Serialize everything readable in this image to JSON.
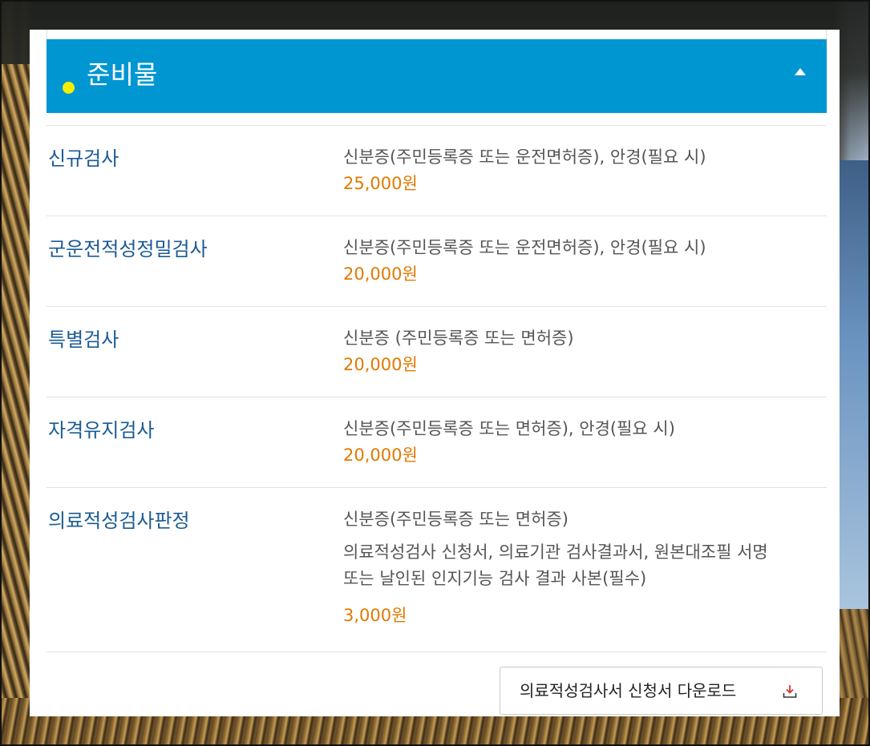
{
  "section": {
    "title": "준비물",
    "collapse_icon": "triangle-up-icon",
    "accent_color": "#0096d2",
    "dot_color": "#f4ee00"
  },
  "rows": [
    {
      "name": "신규검사",
      "requirement": "신분증(주민등록증 또는 운전면허증), 안경(필요 시)",
      "price": "25,000원"
    },
    {
      "name": "군운전적성정밀검사",
      "requirement": "신분증(주민등록증 또는 운전면허증), 안경(필요 시)",
      "price": "20,000원"
    },
    {
      "name": "특별검사",
      "requirement": "신분증 (주민등록증 또는 면허증)",
      "price": "20,000원"
    },
    {
      "name": "자격유지검사",
      "requirement": "신분증(주민등록증 또는 면허증), 안경(필요 시)",
      "price": "20,000원"
    },
    {
      "name": "의료적성검사판정",
      "requirement": "신분증(주민등록증 또는 면허증)",
      "requirement_extra_line1": "의료적성검사 신청서, 의료기관 검사결과서, 원본대조필 서명",
      "requirement_extra_line2": "또는 날인된 인지기능 검사 결과 사본(필수)",
      "price": "3,000원"
    }
  ],
  "download": {
    "label": "의료적성검사서 신청서 다운로드",
    "icon": "download-icon",
    "icon_color": "#e0302a"
  },
  "colors": {
    "row_name": "#1b5b94",
    "price": "#e07a00",
    "text": "#555555"
  }
}
